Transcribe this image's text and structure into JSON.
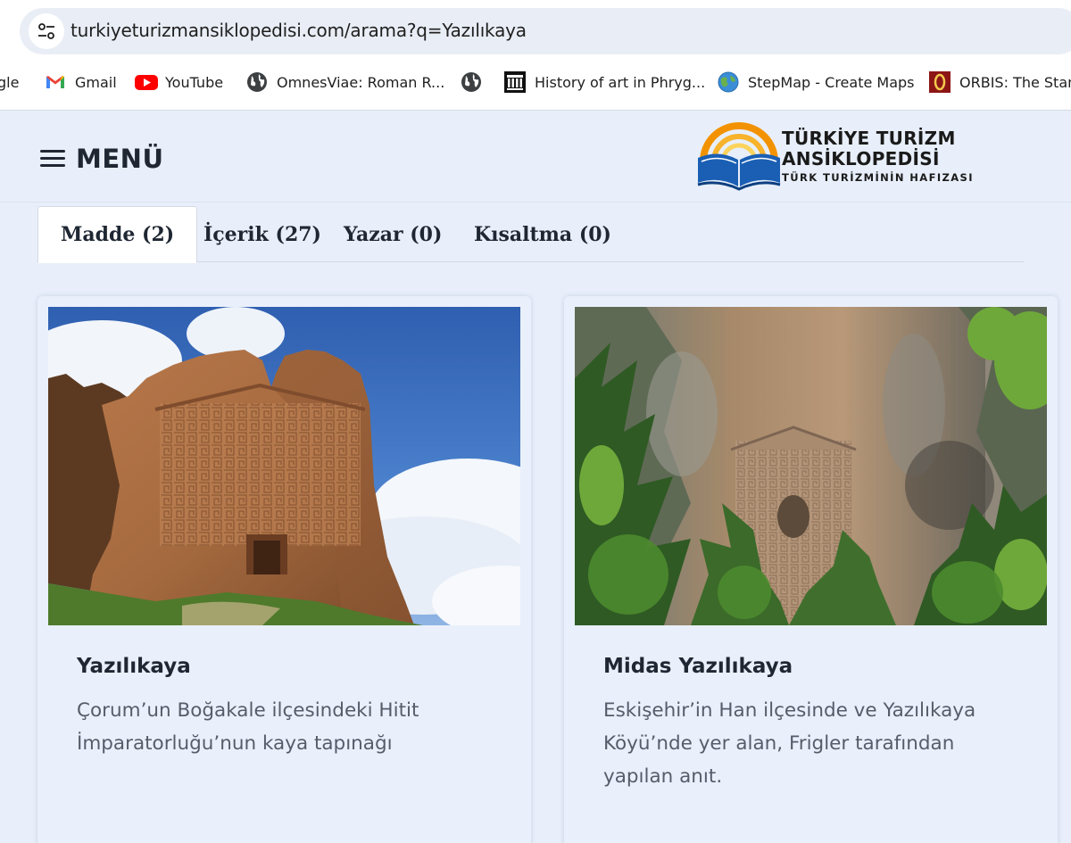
{
  "browser": {
    "url": "turkiyeturizmansiklopedisi.com/arama?q=Yazılıkaya",
    "bookmarks": [
      {
        "label": "gle",
        "icon": "google-icon"
      },
      {
        "label": "Gmail",
        "icon": "gmail-icon"
      },
      {
        "label": "YouTube",
        "icon": "youtube-icon"
      },
      {
        "label": "OmnesViae: Roman R...",
        "icon": "globe-icon"
      },
      {
        "label": "",
        "icon": "globe-icon"
      },
      {
        "label": "History of art in Phryg...",
        "icon": "museum-icon"
      },
      {
        "label": "StepMap - Create Maps",
        "icon": "stepmap-globe-icon"
      },
      {
        "label": "ORBIS: The Stanf",
        "icon": "orbis-icon"
      }
    ]
  },
  "header": {
    "menu_label": "MENÜ",
    "logo": {
      "line1": "TÜRKİYE TURİZM",
      "line2": "ANSİKLOPEDİSİ",
      "line3": "TÜRK TURİZMİNİN HAFIZASI"
    }
  },
  "tabs": [
    {
      "label": "Madde (2)",
      "active": true
    },
    {
      "label": "İçerik (27)",
      "active": false
    },
    {
      "label": "Yazar (0)",
      "active": false
    },
    {
      "label": "Kısaltma (0)",
      "active": false
    }
  ],
  "results": [
    {
      "title": "Yazılıkaya",
      "description": "Çorum’un Boğakale ilçesindeki Hitit İmparatorluğu’nun kaya tapınağı"
    },
    {
      "title": "Midas Yazılıkaya",
      "description": "Eskişehir’in Han ilçesinde ve Yazılıkaya Köyü’nde yer alan, Frigler tarafından yapılan anıt."
    }
  ],
  "colors": {
    "page_bg": "#e8effa",
    "card_bg": "#e9f0fb",
    "text_dark": "#1f2733",
    "text_muted": "#555d6b",
    "logo_blue": "#1a5fb4",
    "logo_orange": "#f39200"
  }
}
